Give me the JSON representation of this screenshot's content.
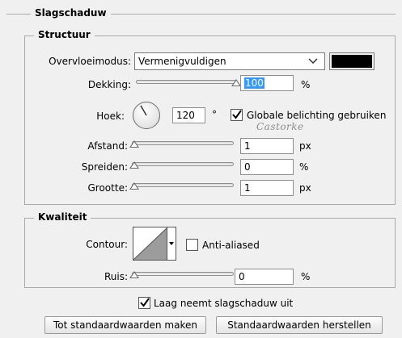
{
  "panel": {
    "section_title": "Slagschaduw",
    "structure_title": "Structuur",
    "quality_title": "Kwaliteit"
  },
  "structure": {
    "blend_mode_label": "Overvloeimodus:",
    "blend_mode_value": "Vermenigvuldigen",
    "shadow_color": "#000000",
    "opacity_label": "Dekking:",
    "opacity_value": "100",
    "opacity_unit": "%",
    "opacity_level": 100,
    "angle_label": "Hoek:",
    "angle_value": "120",
    "angle_unit": "°",
    "global_light_label": "Globale belichting gebruiken",
    "global_light_checked": true,
    "watermark": "Castorke",
    "distance_label": "Afstand:",
    "distance_value": "1",
    "distance_unit": "px",
    "spread_label": "Spreiden:",
    "spread_value": "0",
    "spread_unit": "%",
    "size_label": "Grootte:",
    "size_value": "1",
    "size_unit": "px"
  },
  "quality": {
    "contour_label": "Contour:",
    "anti_aliased_label": "Anti-aliased",
    "anti_aliased_checked": false,
    "noise_label": "Ruis:",
    "noise_value": "0",
    "noise_unit": "%"
  },
  "footer": {
    "layer_knocks_out_label": "Laag neemt slagschaduw uit",
    "layer_knocks_out_checked": true,
    "make_default_button": "Tot standaardwaarden maken",
    "reset_default_button": "Standaardwaarden herstellen"
  }
}
